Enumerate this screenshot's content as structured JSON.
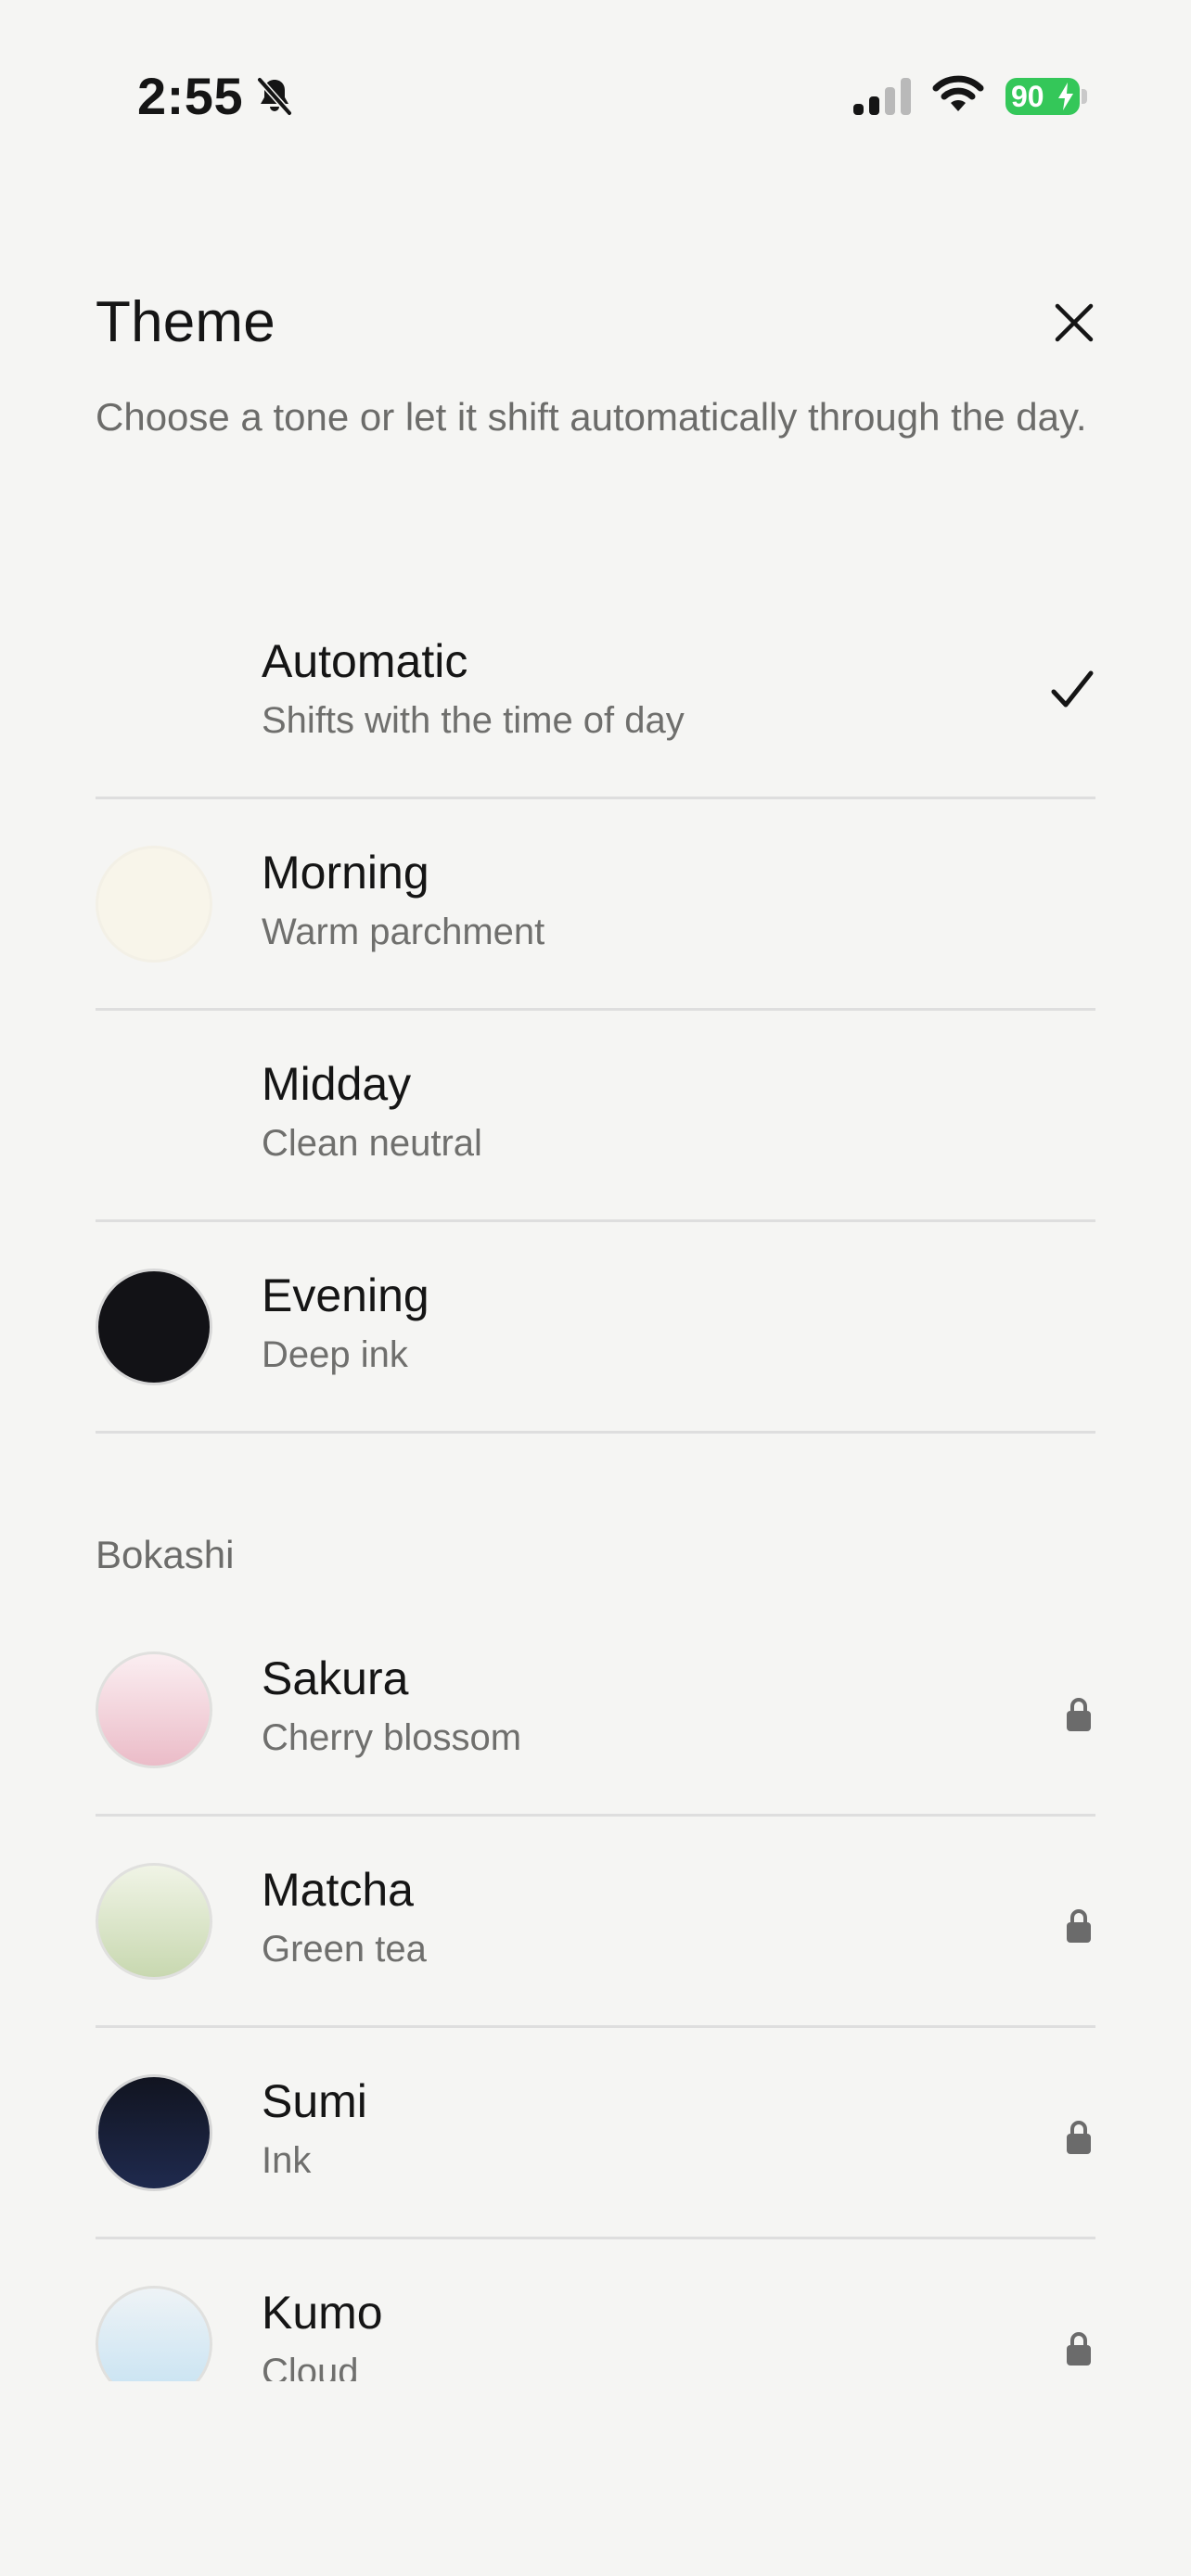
{
  "status_bar": {
    "time": "2:55",
    "battery": "90"
  },
  "header": {
    "title": "Theme",
    "subtitle": "Choose a tone or let it shift automatically through the day."
  },
  "themes": [
    {
      "label": "Automatic",
      "description": "Shifts with the time of day",
      "selected": true
    },
    {
      "label": "Morning",
      "description": "Warm parchment",
      "swatch": "#f8f5ea"
    },
    {
      "label": "Midday",
      "description": "Clean neutral",
      "swatch": "#f5f5f3"
    },
    {
      "label": "Evening",
      "description": "Deep ink",
      "swatch": "#121216"
    }
  ],
  "bokashi": {
    "section_label": "Bokashi",
    "items": [
      {
        "label": "Sakura",
        "description": "Cherry blossom",
        "locked": true,
        "gradient": [
          "#fbeef1",
          "#ebbcc8"
        ]
      },
      {
        "label": "Matcha",
        "description": "Green tea",
        "locked": true,
        "gradient": [
          "#f0f4e6",
          "#c8d8b0"
        ]
      },
      {
        "label": "Sumi",
        "description": "Ink",
        "locked": true,
        "gradient": [
          "#111420",
          "#1f2a4e"
        ]
      },
      {
        "label": "Kumo",
        "description": "Cloud",
        "locked": true,
        "gradient": [
          "#eef3f6",
          "#c6e2f2"
        ]
      }
    ]
  },
  "colors": {
    "background": "#f5f5f3",
    "text_primary": "#151515",
    "text_secondary": "#6f6f6d",
    "divider": "#dedede",
    "battery": "#34c759",
    "lock": "#6b6b6b"
  }
}
